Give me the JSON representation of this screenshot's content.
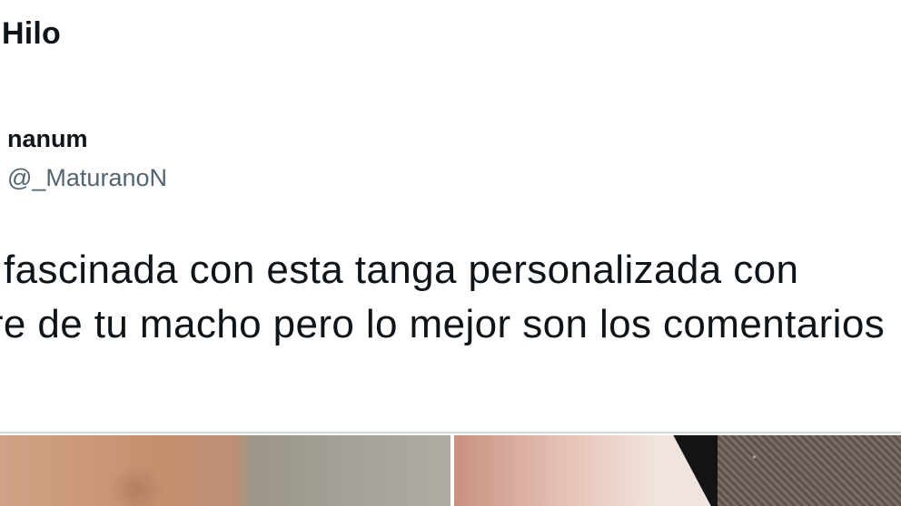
{
  "header": {
    "title": "Hilo"
  },
  "tweet": {
    "author": {
      "display_name": "nanum",
      "handle": "@_MaturanoN"
    },
    "text_lines": [
      "fascinada con esta tanga personalizada con",
      "bre de tu macho pero lo mejor son los comentarios"
    ]
  },
  "media": {
    "count": 2,
    "colors": {
      "divider": "#cfd9de",
      "handle": "#536471",
      "text": "#0f1419"
    }
  }
}
